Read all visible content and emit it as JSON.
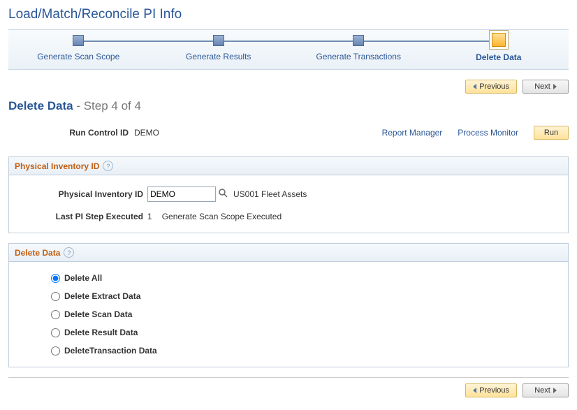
{
  "page_title": "Load/Match/Reconcile PI Info",
  "wizard": {
    "steps": [
      {
        "label": "Generate Scan Scope"
      },
      {
        "label": "Generate Results"
      },
      {
        "label": "Generate Transactions"
      },
      {
        "label": "Delete Data"
      }
    ],
    "active_index": 3
  },
  "nav": {
    "previous": "Previous",
    "next": "Next"
  },
  "subtitle": {
    "main": "Delete Data",
    "sub": " - Step 4 of 4"
  },
  "run_control": {
    "label": "Run Control ID",
    "value": "DEMO",
    "report_manager": "Report Manager",
    "process_monitor": "Process Monitor",
    "run_button": "Run"
  },
  "pi_group": {
    "title": "Physical Inventory ID",
    "pi_label": "Physical Inventory ID",
    "pi_value": "DEMO",
    "pi_desc": "US001 Fleet Assets",
    "last_step_label": "Last PI Step Executed",
    "last_step_num": "1",
    "last_step_desc": "Generate Scan Scope Executed"
  },
  "delete_group": {
    "title": "Delete Data",
    "options": [
      "Delete All",
      "Delete Extract Data",
      "Delete Scan Data",
      "Delete Result Data",
      "DeleteTransaction Data"
    ],
    "selected_index": 0
  }
}
